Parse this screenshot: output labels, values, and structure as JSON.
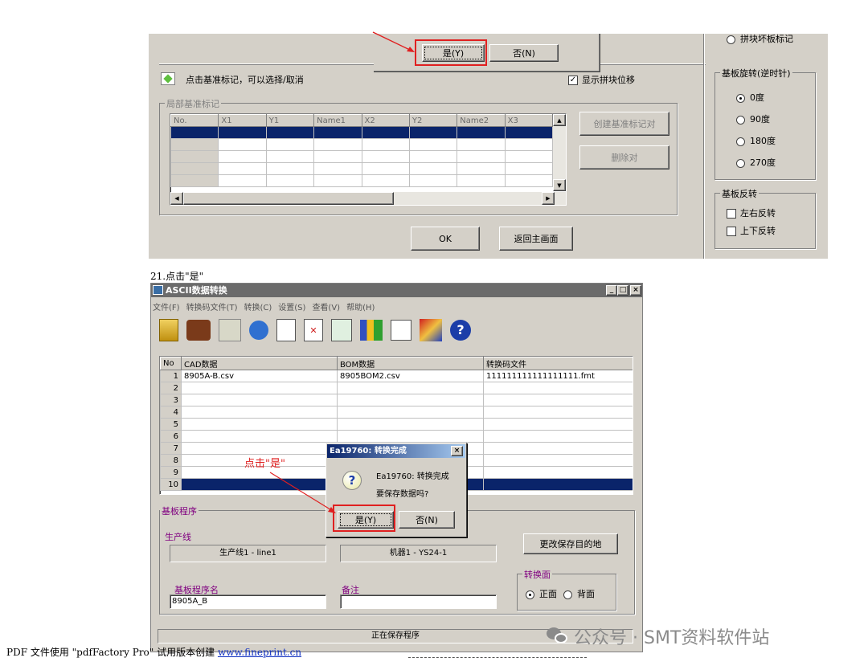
{
  "top_dialog": {
    "confirm_yes": "是(Y)",
    "confirm_no": "否(N)",
    "click_hint": "点击基准标记，可以选择/取消",
    "show_offset_label": "显示拼块位移",
    "show_offset_checked": true,
    "local_group_title": "局部基准标记",
    "grid_headers": [
      "No.",
      "X1",
      "Y1",
      "Name1",
      "X2",
      "Y2",
      "Name2",
      "X3"
    ],
    "create_pair_button": "创建基准标记对",
    "delete_pair_button": "删除对",
    "ok_button": "OK",
    "return_button": "返回主画面",
    "bad_board_label": "拼块坏板标记",
    "rotation_title": "基板旋转(逆时针)",
    "rotations": [
      "0度",
      "90度",
      "180度",
      "270度"
    ],
    "rotation_selected": 0,
    "flip_title": "基板反转",
    "flips": [
      "左右反转",
      "上下反转"
    ]
  },
  "step_caption": "21.点击\"是\"",
  "main_window": {
    "title": "ASCII数据转换",
    "menu": [
      "文件(F)",
      "转换码文件(T)",
      "转换(C)",
      "设置(S)",
      "查看(V)",
      "帮助(H)"
    ],
    "table_headers": [
      "No",
      "CAD数据",
      "BOM数据",
      "转换码文件"
    ],
    "rows": [
      {
        "no": "1",
        "cad": "8905A-B.csv",
        "bom": "8905BOM2.csv",
        "conv": "111111111111111111.fmt"
      },
      {
        "no": "2",
        "cad": "",
        "bom": "",
        "conv": ""
      },
      {
        "no": "3",
        "cad": "",
        "bom": "",
        "conv": ""
      },
      {
        "no": "4",
        "cad": "",
        "bom": "",
        "conv": ""
      },
      {
        "no": "5",
        "cad": "",
        "bom": "",
        "conv": ""
      },
      {
        "no": "6",
        "cad": "",
        "bom": "",
        "conv": ""
      },
      {
        "no": "7",
        "cad": "",
        "bom": "",
        "conv": ""
      },
      {
        "no": "8",
        "cad": "",
        "bom": "",
        "conv": ""
      },
      {
        "no": "9",
        "cad": "",
        "bom": "",
        "conv": ""
      },
      {
        "no": "10",
        "cad": "",
        "bom": "",
        "conv": ""
      }
    ],
    "selected_row": 9,
    "annotation": "点击\"是\"",
    "program_group_title": "基板程序",
    "line_label": "生产线",
    "line_value": "生产线1 - line1",
    "machine_value": "机器1 - YS24-1",
    "change_dest_button": "更改保存目的地",
    "program_name_label": "基板程序名",
    "program_name_value": "8905A_B",
    "remark_label": "备注",
    "remark_value": "",
    "side_group_title": "转换面",
    "side_options": [
      "正面",
      "背面"
    ],
    "side_selected": 0,
    "status_text": "正在保存程序"
  },
  "message_box": {
    "title": "Ea19760: 转换完成",
    "line1": "Ea19760: 转换完成",
    "line2": "要保存数据吗?",
    "yes": "是(Y)",
    "no": "否(N)"
  },
  "footer": {
    "pdf_text": "PDF 文件使用 \"pdfFactory Pro\" 试用版本创建 ",
    "pdf_link": "www.fineprint.cn",
    "watermark": "公众号 · SMT资料软件站"
  },
  "colors": {
    "selection": "#0a246a",
    "annotation_red": "#e02020",
    "title_bar": "#6b6b6b"
  }
}
